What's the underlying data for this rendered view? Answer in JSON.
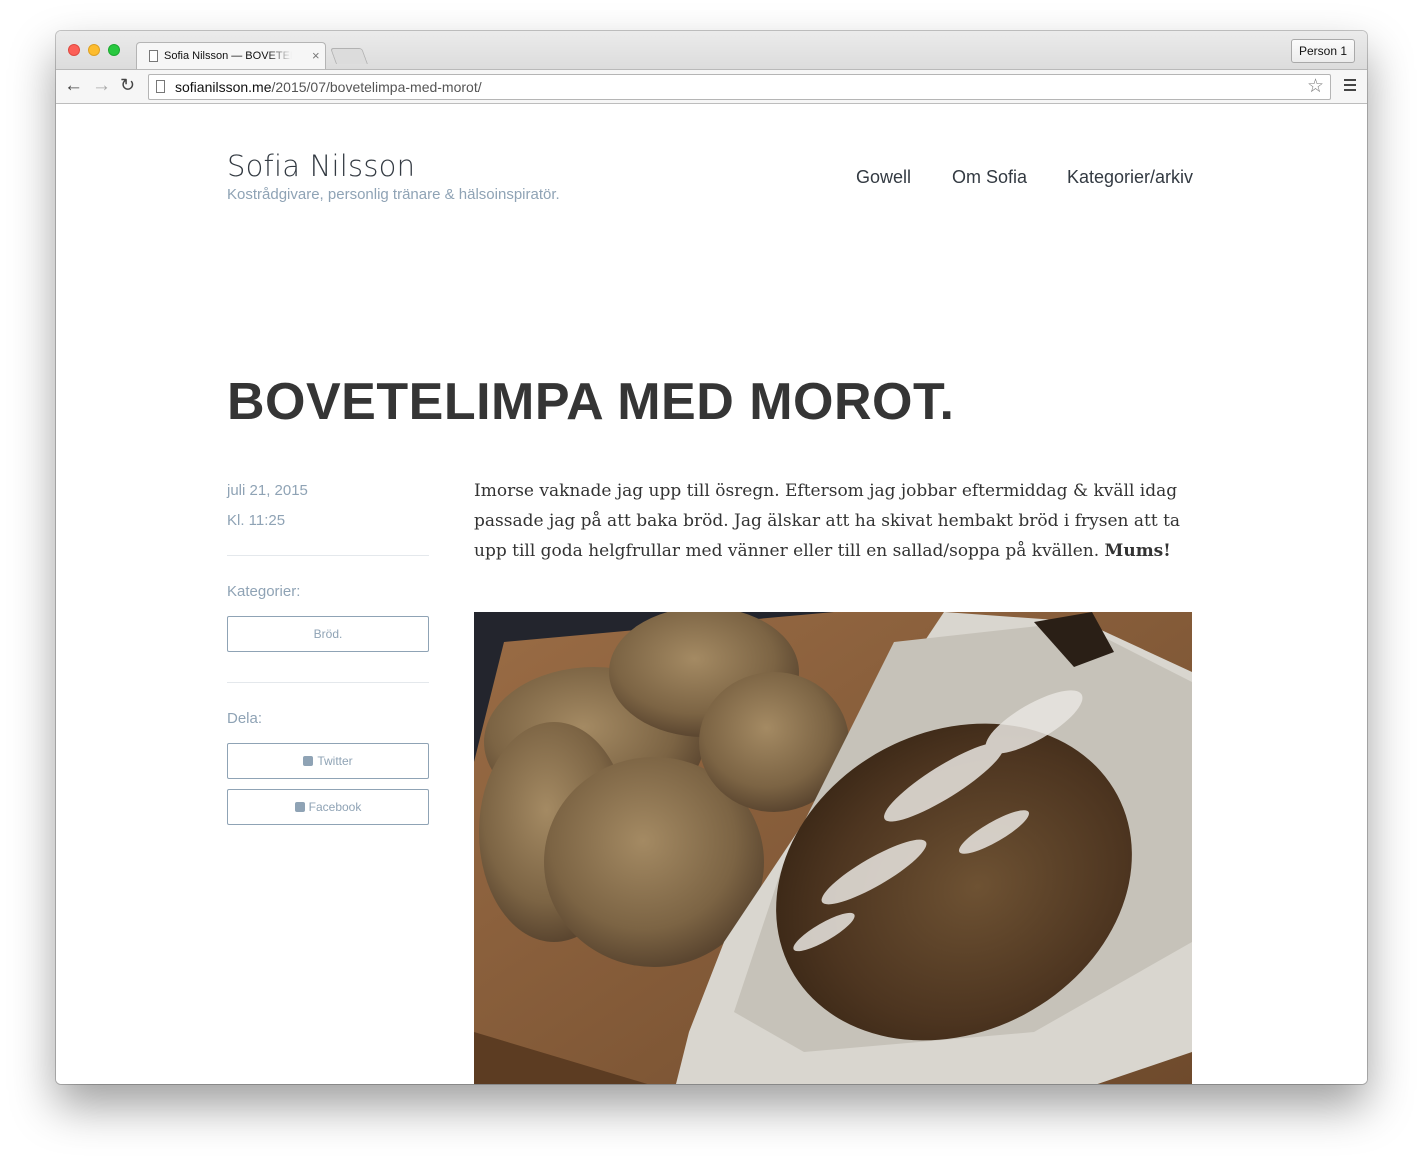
{
  "browser": {
    "tab_title": "Sofia Nilsson — BOVETELIMPA MED MOROT.",
    "tab_close": "×",
    "person_button": "Person 1",
    "url_host": "sofianilsson.me",
    "url_path": "/2015/07/bovetelimpa-med-morot/",
    "icons": [
      "back-icon",
      "forward-icon",
      "reload-icon",
      "star-icon",
      "menu-icon"
    ]
  },
  "site": {
    "title": "Sofia Nilsson",
    "tagline": "Kostrådgivare, personlig tränare & hälsoinspiratör.",
    "nav": [
      "Gowell",
      "Om Sofia",
      "Kategorier/arkiv"
    ]
  },
  "post": {
    "title": "BOVETELIMPA MED MOROT.",
    "date": "juli 21, 2015",
    "time": "Kl. 11:25",
    "categories_label": "Kategorier:",
    "category": "Bröd.",
    "share_label": "Dela:",
    "twitter": "Twitter",
    "facebook": "Facebook",
    "body": "Imorse vaknade jag upp till ösregn. Eftersom jag jobbar eftermiddag & kväll idag passade jag på att baka bröd. Jag älskar att ha skivat hembakt bröd i frysen att ta upp till goda helgfrullar med vänner eller till en sallad/soppa på kvällen. ",
    "body_bold": "Mums!"
  },
  "colors": {
    "accent": "#8fa3b5",
    "text": "#333a42",
    "heading": "#353535"
  }
}
